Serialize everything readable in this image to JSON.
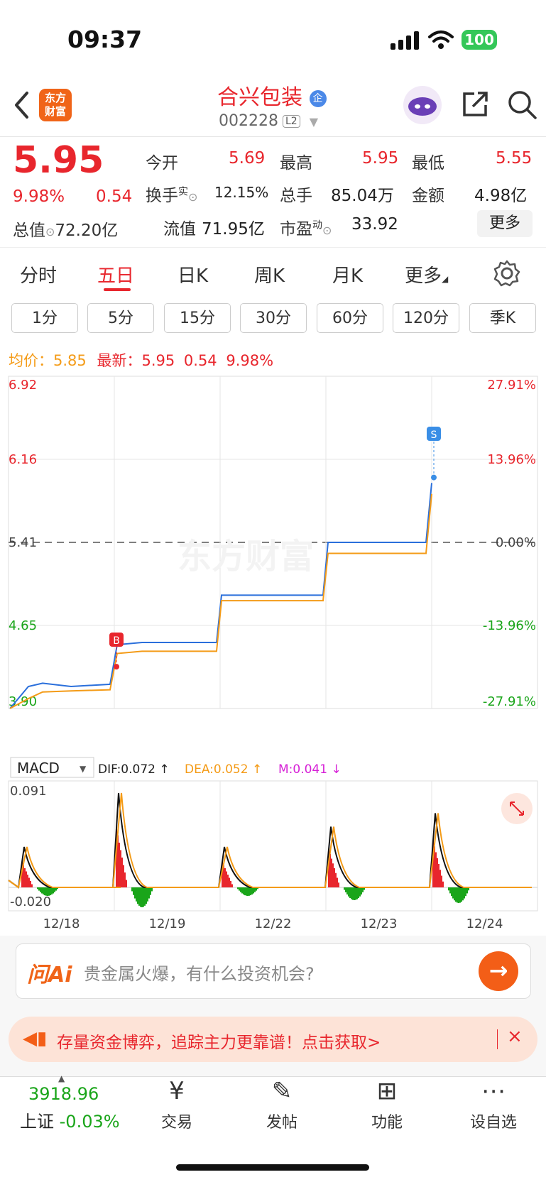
{
  "status": {
    "time": "09:37",
    "battery": "100"
  },
  "header": {
    "logo": [
      "东方",
      "财富"
    ],
    "name": "合兴包装",
    "name_badge": "企",
    "code": "002228",
    "level": "L2"
  },
  "quote": {
    "price": "5.95",
    "change_pct": "9.98%",
    "change": "0.54",
    "open_label": "今开",
    "open": "5.69",
    "high_label": "最高",
    "high": "5.95",
    "low_label": "最低",
    "low": "5.55",
    "turnover_label": "换手",
    "turnover_sup": "实",
    "turnover": "12.15%",
    "volume_label": "总手",
    "volume": "85.04万",
    "amount_label": "金额",
    "amount": "4.98亿",
    "mktcap_label": "总值",
    "mktcap": "72.20亿",
    "float_label": "流值",
    "float": "71.95亿",
    "pe_label": "市盈",
    "pe_sup": "动",
    "pe": "33.92",
    "more": "更多"
  },
  "tabs": [
    "分时",
    "五日",
    "日K",
    "周K",
    "月K",
    "更多"
  ],
  "active_tab": "五日",
  "intervals": [
    "1分",
    "5分",
    "15分",
    "30分",
    "60分",
    "120分",
    "季K"
  ],
  "legend": {
    "avg_label": "均价：",
    "avg": "5.85",
    "latest_label": "最新：",
    "latest": "5.95",
    "chg": "0.54",
    "pct": "9.98%"
  },
  "chart_data": [
    {
      "type": "line",
      "title": "",
      "x": [
        "12/18",
        "12/19",
        "12/22",
        "12/23",
        "12/24"
      ],
      "ylim": [
        3.9,
        6.92
      ],
      "y_ticks_left": [
        "6.92",
        "6.16",
        "5.41",
        "4.65",
        "3.90"
      ],
      "y_ticks_right": [
        "27.91%",
        "13.96%",
        "0.00%",
        "-13.96%",
        "-27.91%"
      ],
      "prev_close": 5.41,
      "series": [
        {
          "color": "#2a6fdb",
          "values": [
            3.9,
            4.1,
            4.13,
            4.1,
            4.12,
            4.48,
            4.5,
            4.5,
            4.93,
            4.93,
            5.41,
            5.41,
            5.95
          ]
        },
        {
          "color": "#f49b17",
          "values": [
            3.9,
            3.99,
            4.05,
            4.06,
            4.07,
            4.4,
            4.42,
            4.42,
            4.88,
            4.88,
            5.31,
            5.31,
            5.85
          ]
        }
      ],
      "markers": [
        {
          "label": "B",
          "color": "#e8262d"
        },
        {
          "label": "S",
          "color": "#3a8ee6"
        }
      ],
      "watermark": "东方财富"
    },
    {
      "type": "line",
      "title": "MACD",
      "selector": "MACD",
      "dif_label": "DIF:0.072 ↑",
      "dea_label": "DEA:0.052 ↑",
      "m_label": "M:0.041 ↓",
      "ylim": [
        -0.02,
        0.091
      ],
      "y_ticks": [
        "0.091",
        "-0.020"
      ]
    }
  ],
  "ai": {
    "logo": "问Ai",
    "placeholder": "贵金属火爆，有什么投资机会?",
    "send": "→"
  },
  "promo": {
    "text": "存量资金博弈，追踪主力更靠谱！点击获取>",
    "close": "×"
  },
  "bottom": {
    "index_value": "3918.96",
    "index_name": "上证",
    "index_change": "-0.03%",
    "items": [
      {
        "label": "交易",
        "icon": "¥"
      },
      {
        "label": "发帖",
        "icon": "✎"
      },
      {
        "label": "功能",
        "icon": "⊞"
      },
      {
        "label": "设自选",
        "icon": "⋯"
      }
    ]
  }
}
